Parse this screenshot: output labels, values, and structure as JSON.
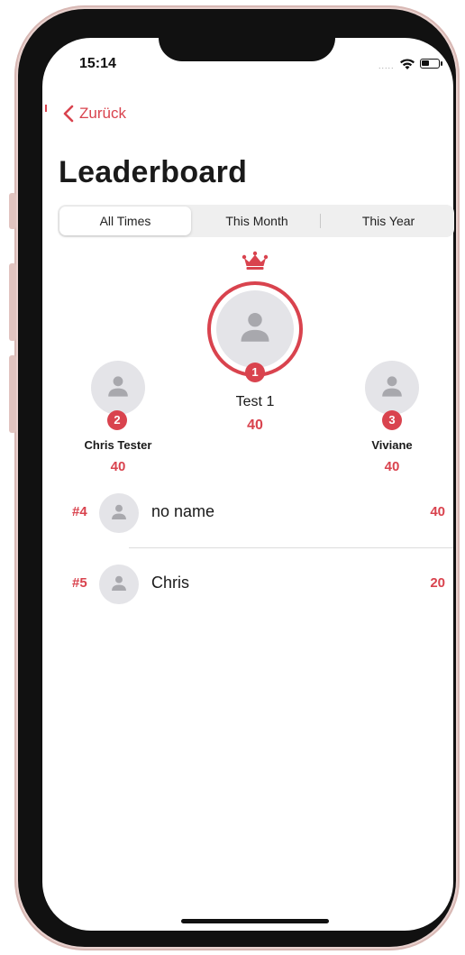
{
  "status_bar": {
    "time": "15:14",
    "signal_dots": "....."
  },
  "nav": {
    "back_label": "Zurück"
  },
  "page": {
    "title": "Leaderboard"
  },
  "tabs": [
    {
      "label": "All Times",
      "active": true
    },
    {
      "label": "This Month",
      "active": false
    },
    {
      "label": "This Year",
      "active": false
    }
  ],
  "podium": {
    "first": {
      "rank": "1",
      "name": "Test 1",
      "score": "40"
    },
    "second": {
      "rank": "2",
      "name": "Chris Tester",
      "score": "40"
    },
    "third": {
      "rank": "3",
      "name": "Viviane",
      "score": "40"
    }
  },
  "list": [
    {
      "rank": "#4",
      "name": "no name",
      "score": "40"
    },
    {
      "rank": "#5",
      "name": "Chris",
      "score": "20"
    }
  ],
  "colors": {
    "accent": "#d9434e",
    "avatar_bg": "#e4e4e8",
    "avatar_icon": "#a8a8ad"
  },
  "icons": {
    "back": "chevron-left-icon",
    "crown": "crown-icon",
    "avatar": "person-placeholder-icon",
    "wifi": "wifi-icon",
    "battery": "battery-icon"
  }
}
